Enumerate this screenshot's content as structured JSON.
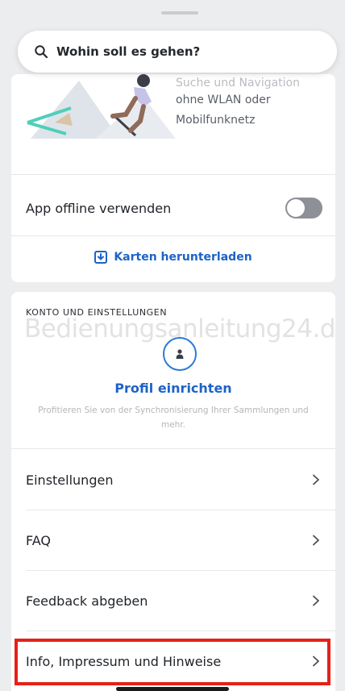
{
  "search": {
    "placeholder": "Wohin soll es gehen?"
  },
  "offline": {
    "promo_line_faded": "Suche und Navigation",
    "promo_line_1": "ohne WLAN oder",
    "promo_line_2": "Mobilfunknetz",
    "toggle_label": "App offline verwenden",
    "toggle_on": false,
    "download_label": "Karten herunterladen"
  },
  "account": {
    "section_title": "KONTO UND EINSTELLUNGEN",
    "watermark": "Bedienungsanleitung24.de",
    "profile_title": "Profil einrichten",
    "profile_desc": "Profitieren Sie von der Synchronisierung Ihrer Sammlungen und mehr."
  },
  "menu": [
    {
      "label": "Einstellungen"
    },
    {
      "label": "FAQ"
    },
    {
      "label": "Feedback abgeben"
    },
    {
      "label": "Info, Impressum und Hinweise"
    }
  ],
  "colors": {
    "accent": "#1d63c7",
    "highlight": "#e62117",
    "toggle_off": "#8d9096"
  }
}
